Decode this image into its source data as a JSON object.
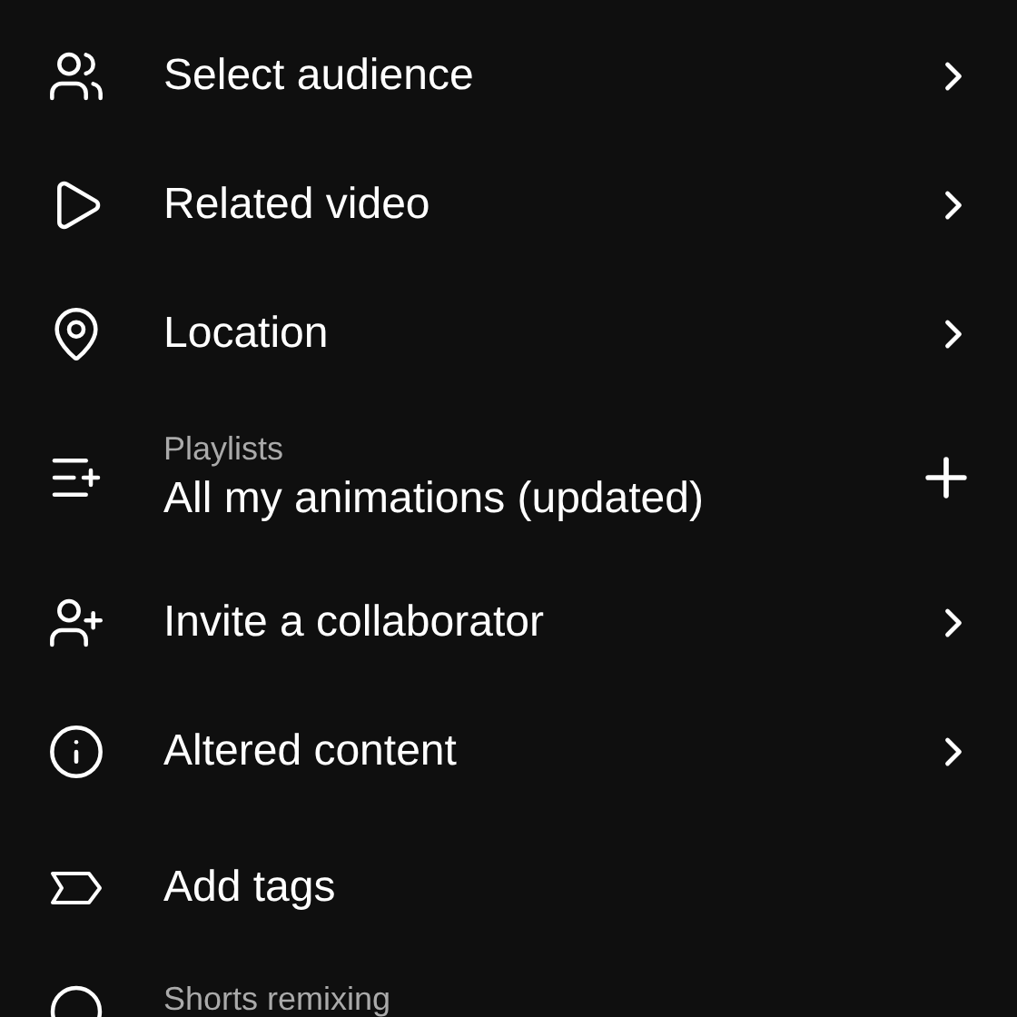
{
  "rows": [
    {
      "kind": "link",
      "label": "Select audience"
    },
    {
      "kind": "link",
      "label": "Related video"
    },
    {
      "kind": "link",
      "label": "Location"
    },
    {
      "kind": "add",
      "subtitle": "Playlists",
      "label": "All my animations (updated)"
    },
    {
      "kind": "link",
      "label": "Invite a collaborator"
    },
    {
      "kind": "link",
      "label": "Altered content"
    },
    {
      "kind": "plain",
      "label": "Add tags"
    },
    {
      "kind": "plain",
      "subtitle": "Shorts remixing"
    }
  ]
}
